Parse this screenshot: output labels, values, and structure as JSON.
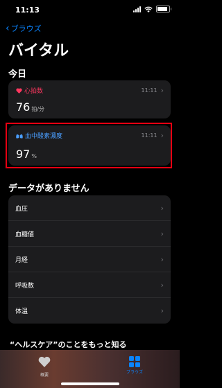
{
  "status_bar": {
    "time": "11:13"
  },
  "nav": {
    "back_label": "ブラウズ",
    "title": "バイタル"
  },
  "today": {
    "header": "今日",
    "cards": [
      {
        "label": "心拍数",
        "time": "11:11",
        "value": "76",
        "unit": "拍/分",
        "icon": "heart-icon",
        "accent": "#ff375f"
      },
      {
        "label": "血中酸素濃度",
        "time": "11:11",
        "value": "97",
        "unit": "%",
        "icon": "lungs-icon",
        "accent": "#4a9eff"
      }
    ]
  },
  "no_data": {
    "header": "データがありません",
    "items": [
      "血圧",
      "血糖値",
      "月経",
      "呼吸数",
      "体温"
    ]
  },
  "footer": {
    "learn_more": "“ヘルスケア”のことをもっと知る"
  },
  "tab_bar": {
    "summary_label": "概要",
    "browse_label": "ブラウズ"
  },
  "colors": {
    "accent": "#0a84ff",
    "highlight_border": "#e60012"
  }
}
